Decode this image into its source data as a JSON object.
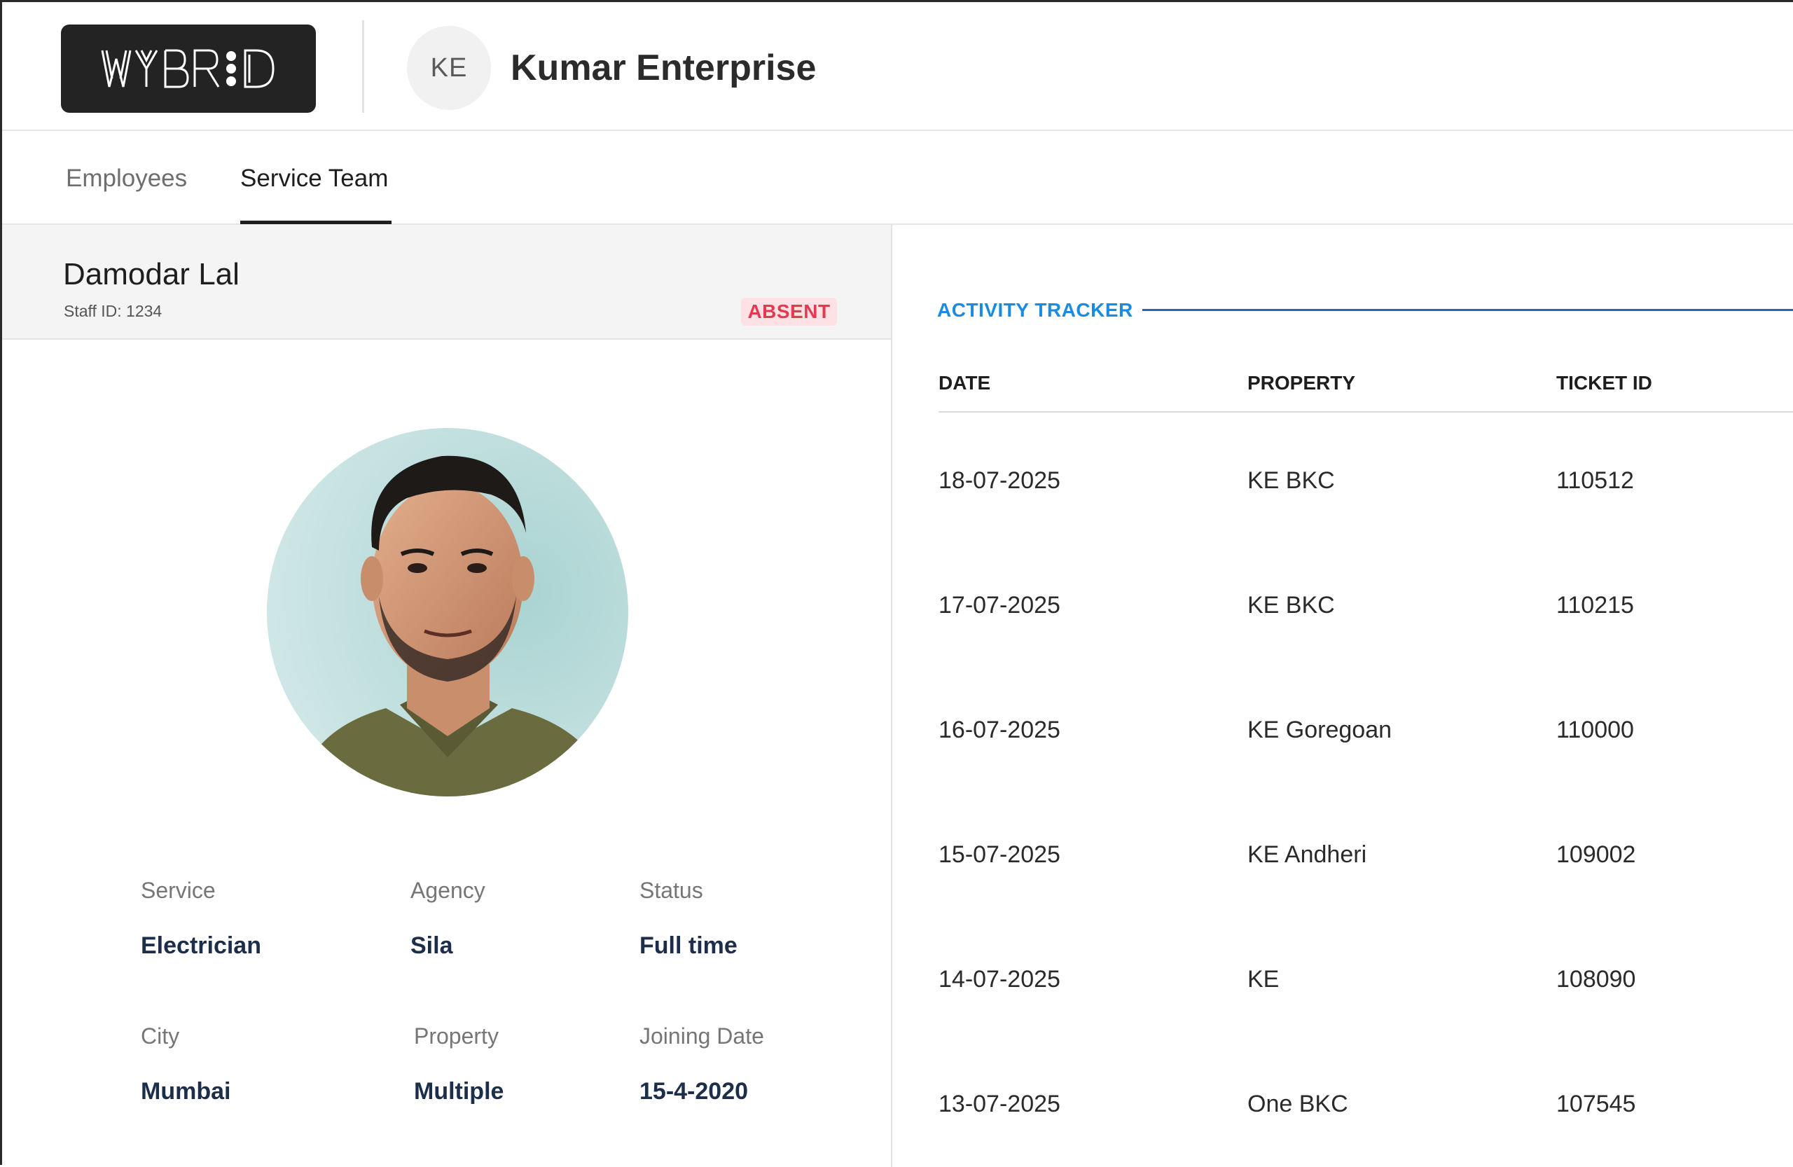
{
  "header": {
    "logo_text": "WYBRID",
    "org_initials": "KE",
    "org_name": "Kumar Enterprise"
  },
  "tabs": [
    {
      "label": "Employees",
      "active": false
    },
    {
      "label": "Service Team",
      "active": true
    }
  ],
  "profile": {
    "name": "Damodar Lal",
    "staff_id": "Staff ID: 1234",
    "status": "ABSENT",
    "status_color": "#e53950",
    "details": [
      {
        "label": "Service",
        "value": "Electrician"
      },
      {
        "label": "Agency",
        "value": "Sila"
      },
      {
        "label": "Status",
        "value": "Full time"
      },
      {
        "label": "City",
        "value": "Mumbai"
      },
      {
        "label": "Property",
        "value": "Multiple"
      },
      {
        "label": "Joining Date",
        "value": "15-4-2020"
      }
    ]
  },
  "activity": {
    "title": "ACTIVITY TRACKER",
    "title_color": "#1a8be0",
    "columns": [
      "DATE",
      "PROPERTY",
      "TICKET ID"
    ],
    "rows": [
      {
        "date": "18-07-2025",
        "property": "KE BKC",
        "ticket_id": "110512"
      },
      {
        "date": "17-07-2025",
        "property": "KE BKC",
        "ticket_id": "110215"
      },
      {
        "date": "16-07-2025",
        "property": "KE Goregoan",
        "ticket_id": "110000"
      },
      {
        "date": "15-07-2025",
        "property": "KE Andheri",
        "ticket_id": "109002"
      },
      {
        "date": "14-07-2025",
        "property": "KE",
        "ticket_id": "108090"
      },
      {
        "date": "13-07-2025",
        "property": "One BKC",
        "ticket_id": "107545"
      }
    ]
  }
}
